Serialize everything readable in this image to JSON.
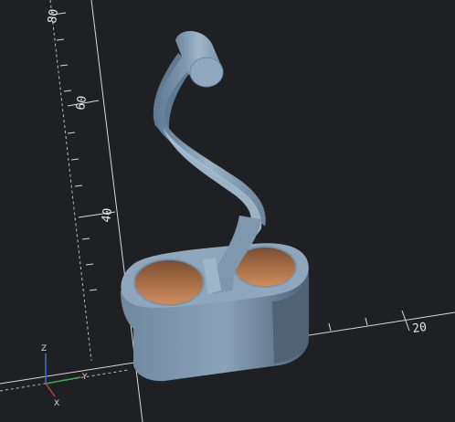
{
  "viewport": {
    "background": "#1f2023",
    "model_color": "#7d96ad",
    "hole_color": "#c08052"
  },
  "axes": {
    "tick_labels": [
      {
        "text": "80"
      },
      {
        "text": "60"
      },
      {
        "text": "40"
      },
      {
        "text": "20"
      }
    ],
    "gizmo": {
      "x": "X",
      "y": "Y",
      "z": "Z"
    }
  }
}
